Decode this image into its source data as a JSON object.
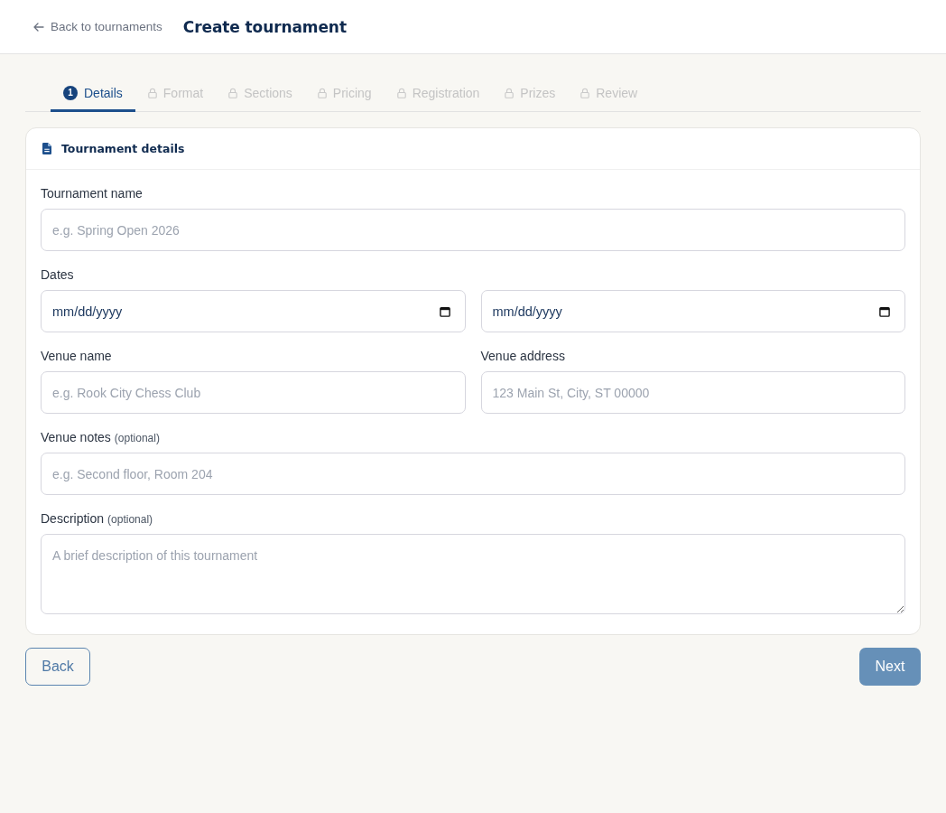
{
  "header": {
    "back_link": "Back to tournaments",
    "title": "Create tournament"
  },
  "steps": [
    {
      "number": "1",
      "label": "Details",
      "selected": true,
      "locked": false
    },
    {
      "label": "Format",
      "selected": false,
      "locked": true
    },
    {
      "label": "Sections",
      "selected": false,
      "locked": true
    },
    {
      "label": "Pricing",
      "selected": false,
      "locked": true
    },
    {
      "label": "Registration",
      "selected": false,
      "locked": true
    },
    {
      "label": "Prizes",
      "selected": false,
      "locked": true
    },
    {
      "label": "Review",
      "selected": false,
      "locked": true
    }
  ],
  "card": {
    "title": "Tournament details",
    "rows": [
      [
        {
          "kind": "text",
          "label": "Tournament name",
          "placeholder": "e.g. Spring Open 2026"
        }
      ],
      [
        {
          "kind": "date_range",
          "label": "Dates",
          "values": [
            "mm/dd/yyyy",
            "mm/dd/yyyy"
          ]
        }
      ],
      [
        {
          "kind": "text",
          "label": "Venue name",
          "placeholder": "e.g. Rook City Chess Club"
        },
        {
          "kind": "text",
          "label": "Venue address",
          "placeholder": "123 Main St, City, ST 00000"
        }
      ],
      [
        {
          "kind": "text",
          "label": "Venue notes",
          "hint": "(optional)",
          "placeholder": "e.g. Second floor, Room 204"
        }
      ],
      [
        {
          "kind": "textarea",
          "label": "Description",
          "hint": "(optional)",
          "placeholder": "A brief description of this tournament"
        }
      ]
    ]
  },
  "actions": {
    "back": {
      "label": "Back",
      "disabled": false
    },
    "next": {
      "label": "Next",
      "disabled": true
    }
  }
}
